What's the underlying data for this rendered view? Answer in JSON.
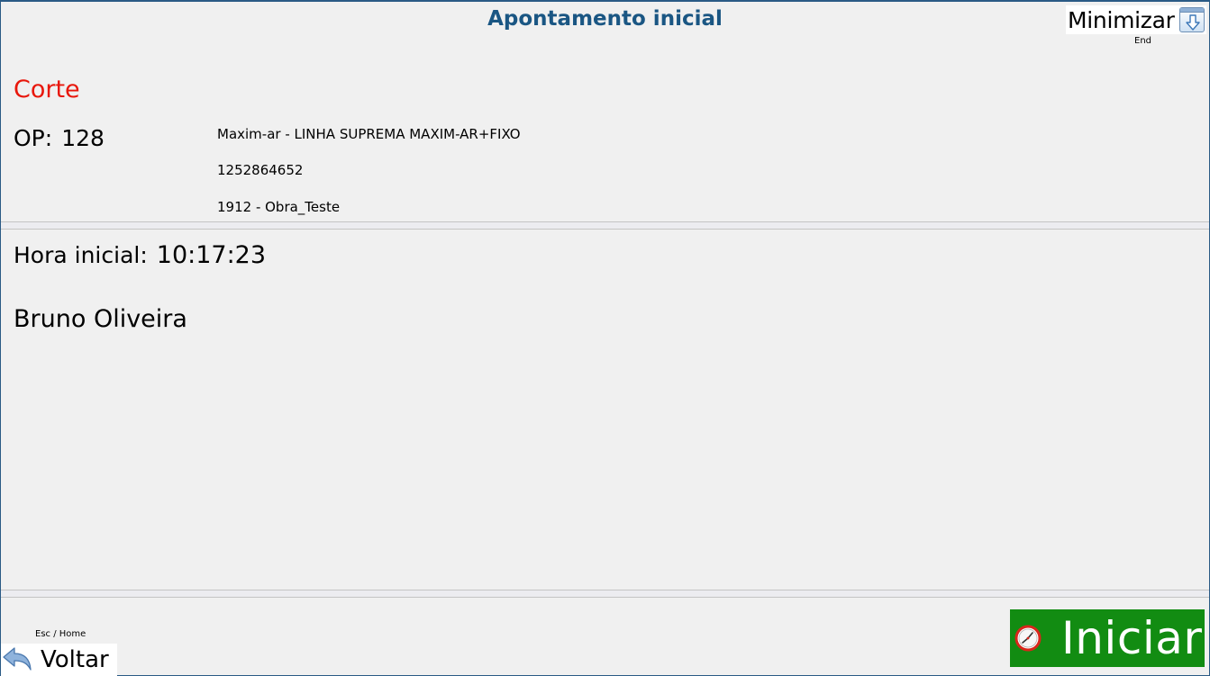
{
  "window": {
    "title": "Apontamento inicial"
  },
  "minimize": {
    "label": "Minimizar",
    "hint": "End",
    "icon": "arrow-down-icon"
  },
  "section": {
    "title": "Corte",
    "color": "#e8170b"
  },
  "order": {
    "label": "OP:",
    "number": "128",
    "details": [
      "Maxim-ar - LINHA  SUPREMA MAXIM-AR+FIXO",
      "1252864652",
      "1912 - Obra_Teste"
    ]
  },
  "start_time": {
    "label": "Hora inicial:",
    "value": "10:17:23"
  },
  "operator": {
    "name": "Bruno Oliveira"
  },
  "back": {
    "hint": "Esc / Home",
    "label": "Voltar",
    "icon": "back-arrow-icon"
  },
  "start_button": {
    "label": "Iniciar",
    "icon": "clock-icon",
    "color": "#128c12"
  }
}
